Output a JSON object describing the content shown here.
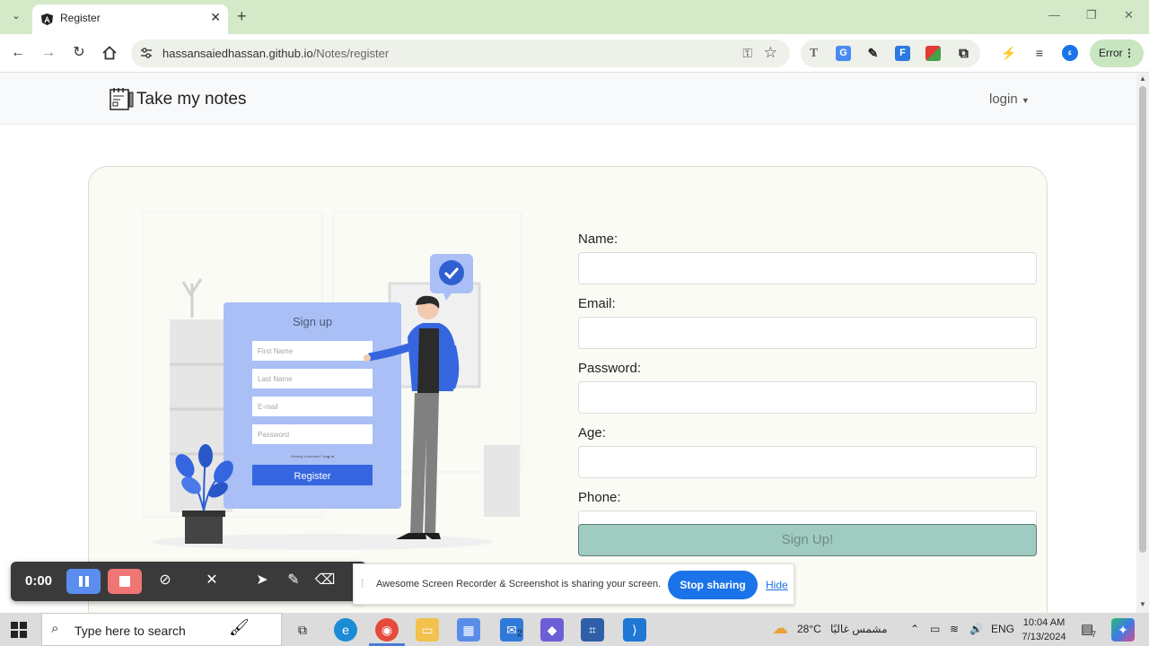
{
  "browser": {
    "tab_title": "Register",
    "url_domain": "hassansaiedhassan.github.io",
    "url_path": "/Notes/register",
    "error_label": "Error",
    "profile_letter": "ء"
  },
  "navbar": {
    "brand": "Take my notes",
    "login_label": "login"
  },
  "illustration": {
    "card_title": "Sign up",
    "fields": [
      "First Name",
      "Last Name",
      "E-mail",
      "Password"
    ],
    "footer_text": "Already a member?",
    "footer_link": "Log in",
    "button": "Register"
  },
  "form": {
    "name_label": "Name:",
    "email_label": "Email:",
    "password_label": "Password:",
    "age_label": "Age:",
    "phone_label": "Phone:",
    "submit_label": "Sign Up!"
  },
  "recorder": {
    "time": "0:00",
    "share_message": "Awesome Screen Recorder & Screenshot is sharing your screen.",
    "stop_label": "Stop sharing",
    "hide_label": "Hide"
  },
  "taskbar": {
    "search_placeholder": "Type here to search",
    "mail_badge": "2",
    "weather_temp": "28°C",
    "weather_text": "مشمس غالبًا",
    "language": "ENG",
    "time": "10:04 AM",
    "date": "7/13/2024",
    "notification_count": "7"
  },
  "colors": {
    "tabstrip": "#d3e9c7",
    "accent_blue": "#1a73e8",
    "illustration_blue": "#3566e0",
    "signup_button": "#9fcbc0"
  }
}
